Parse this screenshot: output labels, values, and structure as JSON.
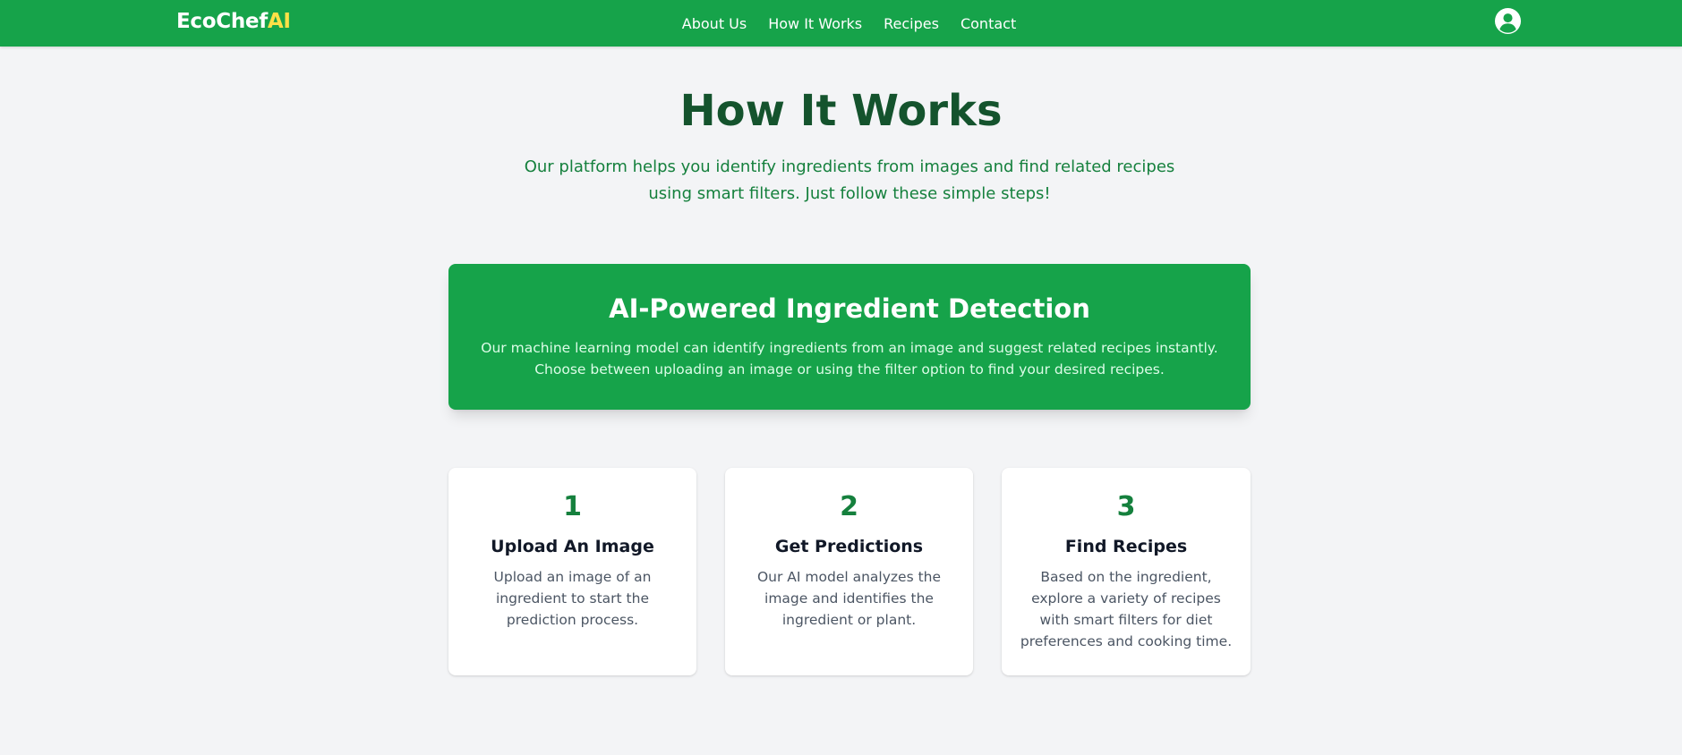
{
  "nav": {
    "logo_main": "EcoChef",
    "logo_accent": "AI",
    "links": [
      "About Us",
      "How It Works",
      "Recipes",
      "Contact"
    ],
    "profile_icon": "user-circle-icon"
  },
  "hero": {
    "title": "How It Works",
    "subtitle": "Our platform helps you identify ingredients from images and find related recipes using smart filters. Just follow these simple steps!"
  },
  "feature": {
    "title": "AI-Powered Ingredient Detection",
    "text": "Our machine learning model can identify ingredients from an image and suggest related recipes instantly. Choose between uploading an image or using the filter option to find your desired recipes."
  },
  "steps": [
    {
      "number": "1",
      "title": "Upload An Image",
      "text": "Upload an image of an ingredient to start the prediction process."
    },
    {
      "number": "2",
      "title": "Get Predictions",
      "text": "Our AI model analyzes the image and identifies the ingredient or plant."
    },
    {
      "number": "3",
      "title": "Find Recipes",
      "text": "Based on the ingredient, explore a variety of recipes with smart filters for diet preferences and cooking time."
    }
  ],
  "colors": {
    "brand_green": "#16a34a",
    "title_green": "#14532d",
    "accent_yellow": "#fde047",
    "background": "#f3f4f6"
  }
}
